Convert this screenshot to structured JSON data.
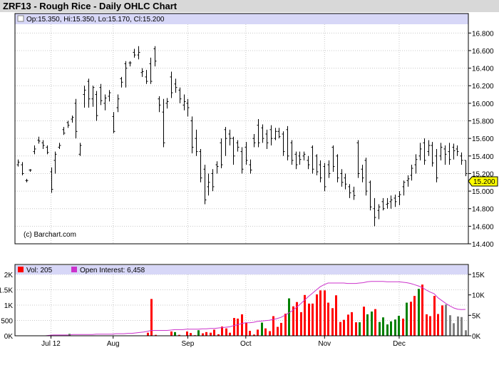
{
  "header": {
    "title": "ZRF13 - Rough Rice - Daily OHLC Chart"
  },
  "price_panel": {
    "legend": "Op:15.350, Hi:15.350, Lo:15.170, Cl:15.200",
    "copyright": "(c) Barchart.com",
    "last_price_label": "15.200"
  },
  "volume_panel": {
    "vol_legend": "Vol: 205",
    "oi_legend": "Open Interest: 6,458"
  },
  "colors": {
    "title_bar": "#d8d8d8",
    "legend_bar": "#d7d7f7",
    "bar_up": "#008000",
    "bar_down": "#ff0000",
    "bar_flat": "#808080",
    "open_interest": "#cc33cc",
    "last_price_box": "#ffff00"
  },
  "chart_data": [
    {
      "type": "ohlc",
      "title": "ZRF13 - Rough Rice - Daily OHLC Chart",
      "ylim": [
        14.4,
        16.9
      ],
      "y_ticks": [
        "14.400",
        "14.600",
        "14.800",
        "15.000",
        "15.200",
        "15.400",
        "15.600",
        "15.800",
        "16.000",
        "16.200",
        "16.400",
        "16.600",
        "16.800"
      ],
      "x_ticks": [
        "Jul 12",
        "Aug",
        "Sep",
        "Oct",
        "Nov",
        "Dec"
      ],
      "x_tick_index": [
        8,
        23,
        41,
        55,
        74,
        92
      ],
      "ohlc": [
        [
          15.3,
          15.36,
          15.28,
          15.33
        ],
        [
          15.3,
          15.33,
          15.18,
          15.2
        ],
        [
          15.12,
          15.14,
          15.1,
          15.12
        ],
        [
          15.24,
          15.25,
          15.22,
          15.24
        ],
        [
          15.45,
          15.52,
          15.42,
          15.48
        ],
        [
          15.58,
          15.62,
          15.54,
          15.57
        ],
        [
          15.55,
          15.58,
          15.48,
          15.52
        ],
        [
          15.5,
          15.52,
          15.42,
          15.44
        ],
        [
          15.22,
          15.27,
          14.98,
          15.02
        ],
        [
          15.35,
          15.45,
          15.2,
          15.42
        ],
        [
          15.5,
          15.55,
          15.48,
          15.52
        ],
        [
          15.7,
          15.73,
          15.64,
          15.66
        ],
        [
          15.78,
          15.8,
          15.72,
          15.75
        ],
        [
          15.82,
          15.86,
          15.78,
          15.84
        ],
        [
          16.0,
          16.05,
          15.6,
          15.68
        ],
        [
          15.42,
          15.55,
          15.4,
          15.52
        ],
        [
          16.1,
          16.2,
          15.95,
          16.15
        ],
        [
          16.25,
          16.28,
          15.95,
          16.05
        ],
        [
          16.05,
          16.2,
          15.96,
          16.18
        ],
        [
          16.1,
          16.14,
          15.8,
          15.86
        ],
        [
          16.18,
          16.22,
          15.98,
          16.03
        ],
        [
          16.0,
          16.1,
          15.92,
          16.06
        ],
        [
          16.08,
          16.15,
          16.02,
          16.12
        ],
        [
          15.85,
          15.9,
          15.66,
          15.68
        ],
        [
          15.95,
          16.1,
          15.9,
          16.05
        ],
        [
          16.28,
          16.3,
          16.18,
          16.24
        ],
        [
          16.45,
          16.48,
          16.18,
          16.4
        ],
        [
          16.46,
          16.48,
          16.42,
          16.46
        ],
        [
          16.58,
          16.62,
          16.52,
          16.55
        ],
        [
          16.55,
          16.65,
          16.5,
          16.58
        ],
        [
          16.35,
          16.4,
          16.3,
          16.36
        ],
        [
          16.3,
          16.38,
          16.22,
          16.25
        ],
        [
          16.45,
          16.52,
          16.22,
          16.25
        ],
        [
          16.62,
          16.65,
          16.42,
          16.48
        ],
        [
          16.05,
          16.08,
          15.9,
          15.98
        ],
        [
          15.9,
          16.05,
          15.5,
          15.55
        ],
        [
          16.0,
          16.06,
          15.94,
          16.02
        ],
        [
          16.3,
          16.36,
          16.06,
          16.12
        ],
        [
          16.22,
          16.28,
          16.12,
          16.18
        ],
        [
          16.15,
          16.18,
          16.0,
          16.05
        ],
        [
          15.98,
          16.1,
          15.92,
          16.02
        ],
        [
          16.0,
          16.05,
          15.85,
          15.95
        ],
        [
          15.8,
          15.85,
          15.43,
          15.5
        ],
        [
          15.6,
          15.7,
          15.4,
          15.45
        ],
        [
          15.45,
          15.48,
          15.1,
          15.15
        ],
        [
          15.25,
          15.3,
          14.85,
          14.9
        ],
        [
          15.05,
          15.2,
          14.95,
          15.1
        ],
        [
          15.2,
          15.25,
          15.0,
          15.05
        ],
        [
          15.3,
          15.34,
          15.2,
          15.28
        ],
        [
          15.55,
          15.6,
          15.26,
          15.3
        ],
        [
          15.7,
          15.73,
          15.4,
          15.6
        ],
        [
          15.65,
          15.7,
          15.52,
          15.6
        ],
        [
          15.6,
          15.62,
          15.3,
          15.4
        ],
        [
          15.55,
          15.58,
          15.45,
          15.5
        ],
        [
          15.45,
          15.5,
          15.2,
          15.25
        ],
        [
          15.5,
          15.56,
          15.3,
          15.35
        ],
        [
          15.3,
          15.36,
          15.2,
          15.24
        ],
        [
          15.6,
          15.65,
          15.5,
          15.55
        ],
        [
          15.75,
          15.82,
          15.5,
          15.55
        ],
        [
          15.72,
          15.76,
          15.55,
          15.6
        ],
        [
          15.65,
          15.7,
          15.48,
          15.55
        ],
        [
          15.7,
          15.75,
          15.52,
          15.6
        ],
        [
          15.6,
          15.72,
          15.58,
          15.68
        ],
        [
          15.68,
          15.72,
          15.6,
          15.62
        ],
        [
          15.65,
          15.68,
          15.4,
          15.45
        ],
        [
          15.7,
          15.74,
          15.35,
          15.4
        ],
        [
          15.55,
          15.58,
          15.3,
          15.35
        ],
        [
          15.42,
          15.45,
          15.25,
          15.3
        ],
        [
          15.4,
          15.45,
          15.3,
          15.36
        ],
        [
          15.4,
          15.45,
          15.35,
          15.42
        ],
        [
          15.35,
          15.4,
          15.25,
          15.3
        ],
        [
          15.5,
          15.52,
          15.2,
          15.25
        ],
        [
          15.4,
          15.42,
          15.18,
          15.22
        ],
        [
          15.3,
          15.35,
          15.1,
          15.15
        ],
        [
          15.28,
          15.32,
          15.0,
          15.05
        ],
        [
          15.3,
          15.35,
          15.15,
          15.2
        ],
        [
          15.5,
          15.52,
          15.22,
          15.28
        ],
        [
          15.4,
          15.42,
          15.1,
          15.15
        ],
        [
          15.2,
          15.25,
          15.05,
          15.1
        ],
        [
          15.15,
          15.2,
          15.02,
          15.08
        ],
        [
          15.05,
          15.08,
          14.92,
          14.98
        ],
        [
          15.0,
          15.05,
          14.9,
          14.95
        ],
        [
          15.55,
          15.58,
          15.15,
          15.2
        ],
        [
          15.25,
          15.3,
          15.1,
          15.15
        ],
        [
          15.35,
          15.38,
          14.95,
          15.0
        ],
        [
          15.1,
          15.12,
          14.78,
          14.82
        ],
        [
          14.8,
          14.92,
          14.6,
          14.7
        ],
        [
          14.78,
          14.85,
          14.68,
          14.82
        ],
        [
          14.88,
          14.92,
          14.78,
          14.8
        ],
        [
          14.85,
          14.92,
          14.8,
          14.86
        ],
        [
          14.88,
          14.95,
          14.8,
          14.9
        ],
        [
          14.92,
          14.96,
          14.82,
          14.88
        ],
        [
          14.94,
          15.0,
          14.84,
          14.96
        ],
        [
          15.05,
          15.12,
          14.95,
          15.1
        ],
        [
          15.12,
          15.18,
          15.05,
          15.14
        ],
        [
          15.18,
          15.3,
          15.12,
          15.26
        ],
        [
          15.3,
          15.42,
          15.2,
          15.36
        ],
        [
          15.4,
          15.55,
          15.35,
          15.48
        ],
        [
          15.55,
          15.6,
          15.3,
          15.35
        ],
        [
          15.45,
          15.58,
          15.4,
          15.52
        ],
        [
          15.52,
          15.56,
          15.28,
          15.32
        ],
        [
          15.4,
          15.48,
          15.1,
          15.15
        ],
        [
          15.4,
          15.55,
          15.35,
          15.5
        ],
        [
          15.48,
          15.52,
          15.3,
          15.42
        ],
        [
          15.45,
          15.55,
          15.3,
          15.36
        ],
        [
          15.5,
          15.54,
          15.36,
          15.46
        ],
        [
          15.48,
          15.52,
          15.4,
          15.45
        ],
        [
          15.4,
          15.44,
          15.3,
          15.35
        ],
        [
          15.35,
          15.35,
          15.17,
          15.2
        ]
      ]
    },
    {
      "type": "bar",
      "title": "Vol: 205",
      "ylim": [
        0,
        2000
      ],
      "y_ticks": [
        "0K",
        "500",
        "1K",
        "1.5K",
        "2K"
      ],
      "values": [
        0,
        0,
        0,
        0,
        0,
        0,
        0,
        0,
        10,
        0,
        0,
        0,
        0,
        60,
        10,
        0,
        0,
        0,
        0,
        0,
        0,
        0,
        0,
        10,
        0,
        0,
        0,
        10,
        0,
        0,
        0,
        0,
        0,
        100,
        1200,
        30,
        0,
        0,
        0,
        140,
        120,
        30,
        10,
        140,
        90,
        20,
        180,
        80,
        120,
        100,
        200,
        50,
        300,
        240,
        100,
        580,
        560,
        700,
        420,
        160,
        40,
        200,
        430,
        240,
        150,
        640,
        290,
        420,
        720,
        1220,
        960,
        1100,
        770,
        1330,
        1050,
        1050,
        1350,
        1480,
        1480,
        1080,
        900,
        1320,
        450,
        520,
        690,
        770,
        440,
        440,
        950,
        700,
        790,
        870,
        450,
        600,
        370,
        470,
        530,
        650,
        560,
        1080,
        1110,
        1300,
        1530,
        1670,
        700,
        640,
        1300,
        710,
        990,
        1020,
        670,
        410,
        630,
        610,
        180
      ]
    },
    {
      "type": "line",
      "title": "Open Interest: 6,458",
      "ylim": [
        0,
        15000
      ],
      "y_ticks": [
        "0K",
        "5K",
        "10K",
        "15K"
      ],
      "values": [
        0,
        0,
        0,
        0,
        0,
        0,
        0,
        0,
        100,
        200,
        200,
        200,
        200,
        200,
        300,
        300,
        300,
        300,
        300,
        300,
        400,
        400,
        400,
        400,
        400,
        500,
        500,
        500,
        600,
        600,
        700,
        800,
        900,
        1100,
        1300,
        1300,
        1300,
        1300,
        1300,
        1400,
        1500,
        1500,
        1500,
        1600,
        1600,
        1600,
        1600,
        1700,
        1700,
        1800,
        1800,
        1900,
        2000,
        2100,
        2200,
        2500,
        2700,
        3000,
        3200,
        3200,
        3300,
        3500,
        3600,
        3700,
        3800,
        4000,
        4200,
        4500,
        5000,
        5600,
        6200,
        7000,
        7800,
        8700,
        9600,
        10400,
        11200,
        12000,
        12500,
        12900,
        12900,
        12900,
        12900,
        12900,
        12800,
        12800,
        12800,
        12900,
        13000,
        13200,
        13300,
        13300,
        13300,
        13300,
        13200,
        13200,
        13200,
        13200,
        13100,
        13000,
        12800,
        12500,
        12200,
        11800,
        11200,
        10700,
        10300,
        9300,
        8600,
        7900,
        7300,
        6800,
        6500,
        6400,
        6458
      ]
    }
  ]
}
